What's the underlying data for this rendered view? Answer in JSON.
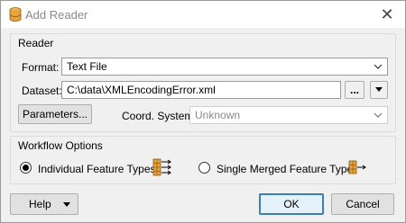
{
  "window": {
    "title": "Add Reader",
    "close_label": "✕"
  },
  "reader": {
    "group_title": "Reader",
    "format_label": "Format:",
    "format_value": "Text File",
    "dataset_label": "Dataset:",
    "dataset_value": "C:\\data\\XMLEncodingError.xml",
    "browse_label": "...",
    "parameters_label": "Parameters...",
    "coord_label": "Coord. System:",
    "coord_value": "Unknown"
  },
  "workflow": {
    "group_title": "Workflow Options",
    "option_individual": "Individual Feature Types",
    "option_merged": "Single Merged Feature Type",
    "selected": "individual"
  },
  "footer": {
    "help_label": "Help",
    "ok_label": "OK",
    "cancel_label": "Cancel"
  },
  "colors": {
    "primary_border": "#3c7fb1",
    "icon_orange": "#e8a33d"
  }
}
